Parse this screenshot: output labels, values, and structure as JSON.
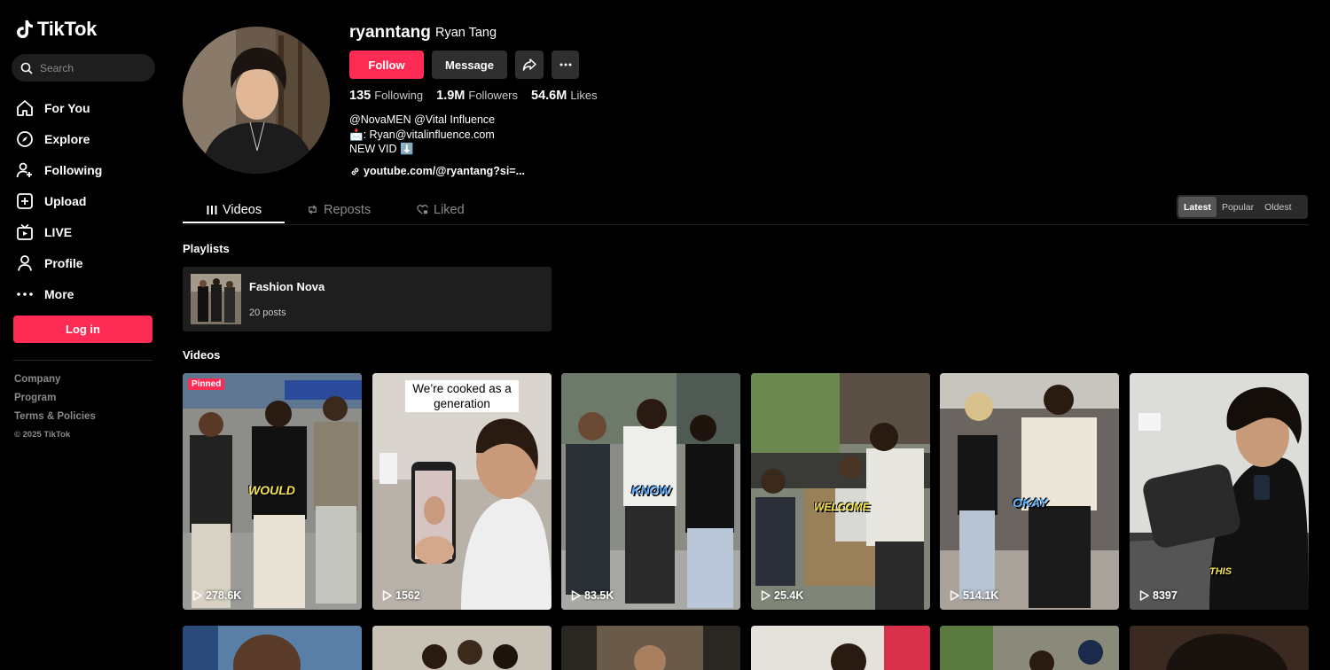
{
  "brand": {
    "name": "TikTok"
  },
  "search": {
    "placeholder": "Search"
  },
  "nav": [
    {
      "label": "For You",
      "icon": "home-icon"
    },
    {
      "label": "Explore",
      "icon": "compass-icon"
    },
    {
      "label": "Following",
      "icon": "following-icon"
    },
    {
      "label": "Upload",
      "icon": "upload-icon"
    },
    {
      "label": "LIVE",
      "icon": "live-icon"
    },
    {
      "label": "Profile",
      "icon": "profile-icon"
    },
    {
      "label": "More",
      "icon": "more-icon"
    }
  ],
  "login_label": "Log in",
  "footer": {
    "company": "Company",
    "program": "Program",
    "terms": "Terms & Policies",
    "copyright": "© 2025 TikTok"
  },
  "profile": {
    "username": "ryanntang",
    "nickname": "Ryan Tang",
    "follow_label": "Follow",
    "message_label": "Message",
    "following_count": "135",
    "following_label": "Following",
    "followers_count": "1.9M",
    "followers_label": "Followers",
    "likes_count": "54.6M",
    "likes_label": "Likes",
    "bio_line1": "@NovaMEN @Vital Influence",
    "bio_line2": "📩: Ryan@vitalinfluence.com",
    "bio_line3": "NEW VID ⬇️",
    "link": "youtube.com/@ryantang?si=..."
  },
  "tabs": {
    "videos": "Videos",
    "reposts": "Reposts",
    "liked": "Liked"
  },
  "sort": {
    "latest": "Latest",
    "popular": "Popular",
    "oldest": "Oldest"
  },
  "sections": {
    "playlists": "Playlists",
    "videos": "Videos"
  },
  "playlist": {
    "name": "Fashion Nova",
    "count": "20 posts"
  },
  "videos": [
    {
      "views": "278.6K",
      "pinned": "Pinned",
      "caption": "WOULD"
    },
    {
      "views": "1562",
      "caption": "We’re cooked as a generation"
    },
    {
      "views": "83.5K",
      "caption": "KNOW"
    },
    {
      "views": "25.4K",
      "caption": "WELCOME"
    },
    {
      "views": "514.1K",
      "caption": "OKAY"
    },
    {
      "views": "8397",
      "caption": "THIS"
    }
  ],
  "colors": {
    "accent": "#fe2c55",
    "background": "#000000",
    "surface": "#1e1e1e"
  }
}
